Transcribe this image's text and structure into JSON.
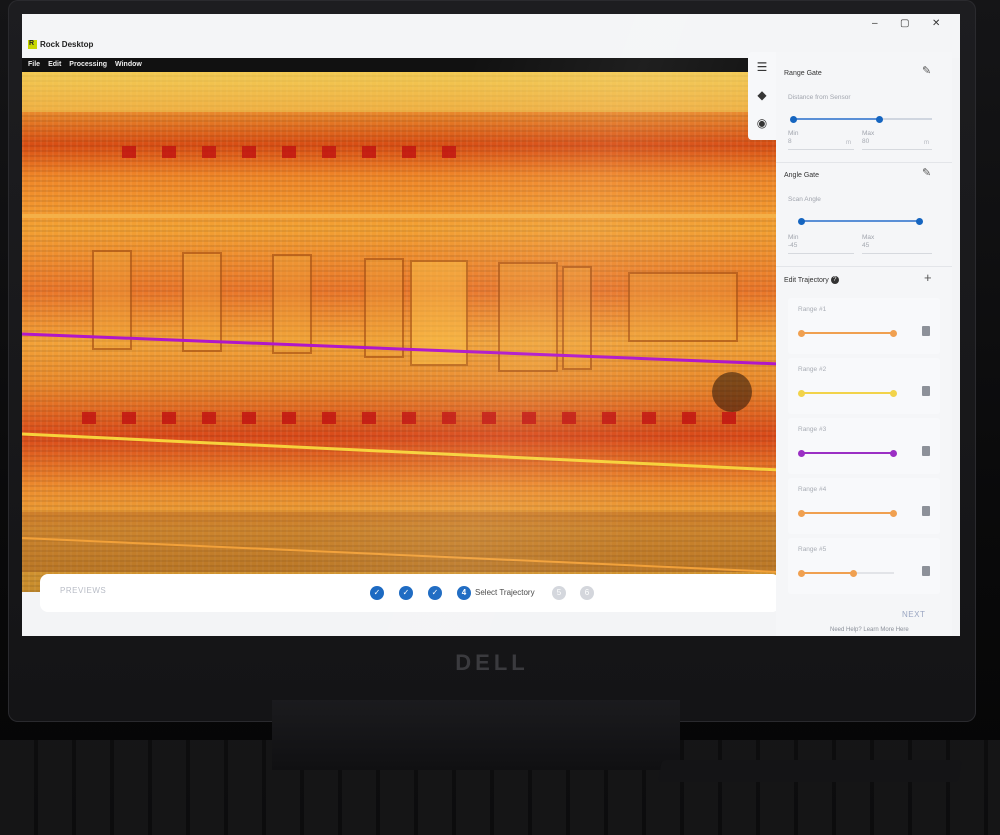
{
  "app": {
    "title": "Rock Desktop",
    "icon_letter": "R",
    "menu": [
      "File",
      "Edit",
      "Processing",
      "Window"
    ],
    "window_controls": [
      "–",
      "▢",
      "✕"
    ]
  },
  "range_gate": {
    "title": "Range Gate",
    "subtitle": "Distance from Sensor",
    "min_label": "Min",
    "max_label": "Max",
    "min_value": "8",
    "max_value": "80",
    "unit": "m"
  },
  "angle_gate": {
    "title": "Angle Gate",
    "subtitle": "Scan Angle",
    "min_label": "Min",
    "max_label": "Max",
    "min_value": "-45",
    "max_value": "45"
  },
  "edit_trajectory": {
    "title": "Edit Trajectory",
    "help": "?",
    "add": "+",
    "ranges": [
      {
        "name": "Range #1",
        "color": "#f0a050"
      },
      {
        "name": "Range #2",
        "color": "#f2d34a"
      },
      {
        "name": "Range #3",
        "color": "#9b2fc4"
      },
      {
        "name": "Range #4",
        "color": "#f0a050"
      },
      {
        "name": "Range #5",
        "color": "#f0a050"
      }
    ]
  },
  "steps": {
    "previous": "PREVIEWS",
    "next": "NEXT",
    "done_mark": "✓",
    "current_number": "4",
    "current_label": "Select Trajectory",
    "todo": [
      "5",
      "6"
    ]
  },
  "footer": {
    "help_text": "Need Help? Learn More Here"
  },
  "brand": "DELL",
  "colors": {
    "accent": "#1565c0",
    "trajectory_purple": "#b017c9",
    "trajectory_yellow": "#f7d23c"
  }
}
